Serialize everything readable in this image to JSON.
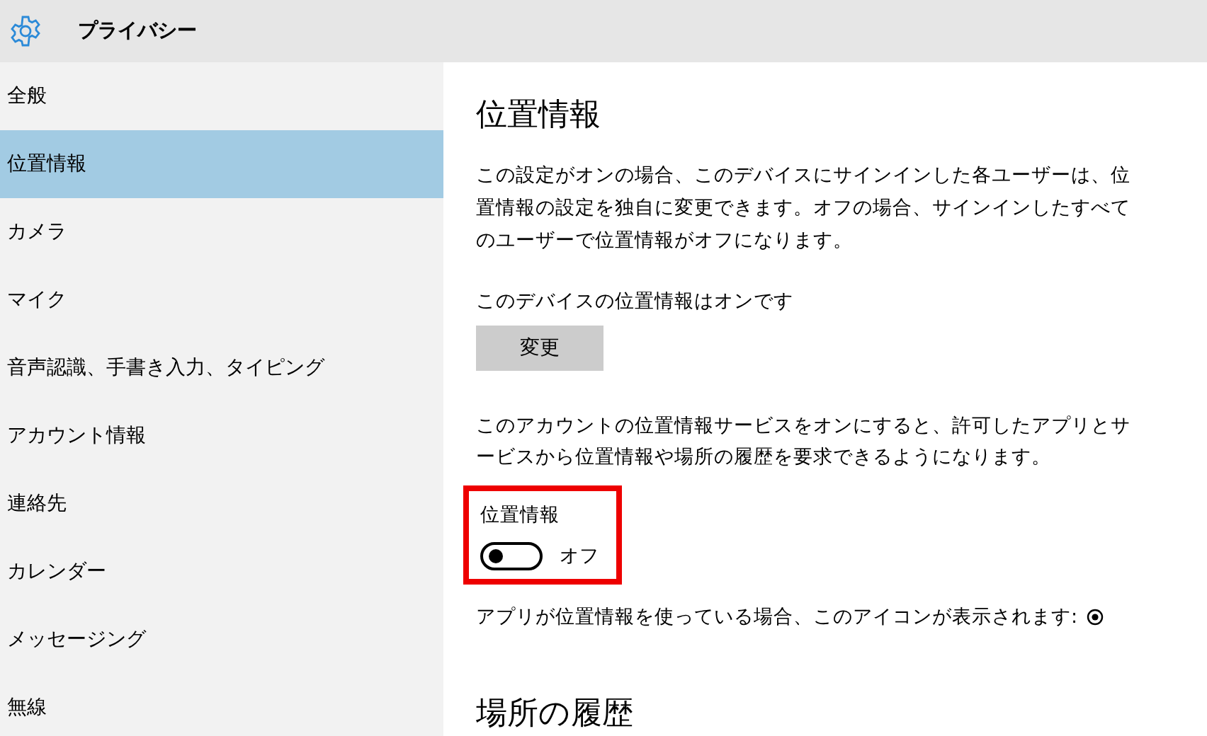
{
  "header": {
    "title": "プライバシー"
  },
  "sidebar": {
    "items": [
      {
        "label": "全般",
        "selected": false
      },
      {
        "label": "位置情報",
        "selected": true
      },
      {
        "label": "カメラ",
        "selected": false
      },
      {
        "label": "マイク",
        "selected": false
      },
      {
        "label": "音声認識、手書き入力、タイピング",
        "selected": false
      },
      {
        "label": "アカウント情報",
        "selected": false
      },
      {
        "label": "連絡先",
        "selected": false
      },
      {
        "label": "カレンダー",
        "selected": false
      },
      {
        "label": "メッセージング",
        "selected": false
      },
      {
        "label": "無線",
        "selected": false
      }
    ]
  },
  "content": {
    "title": "位置情報",
    "description": "この設定がオンの場合、このデバイスにサインインした各ユーザーは、位置情報の設定を独自に変更できます。オフの場合、サインインしたすべてのユーザーで位置情報がオフになります。",
    "device_status": "このデバイスの位置情報はオンです",
    "change_button": "変更",
    "account_description": "このアカウントの位置情報サービスをオンにすると、許可したアプリとサービスから位置情報や場所の履歴を要求できるようになります。",
    "location_toggle": {
      "label": "位置情報",
      "on": false,
      "state_text": "オフ",
      "highlighted": true
    },
    "icon_note": "アプリが位置情報を使っている場合、このアイコンが表示されます:",
    "history_title": "場所の履歴"
  }
}
